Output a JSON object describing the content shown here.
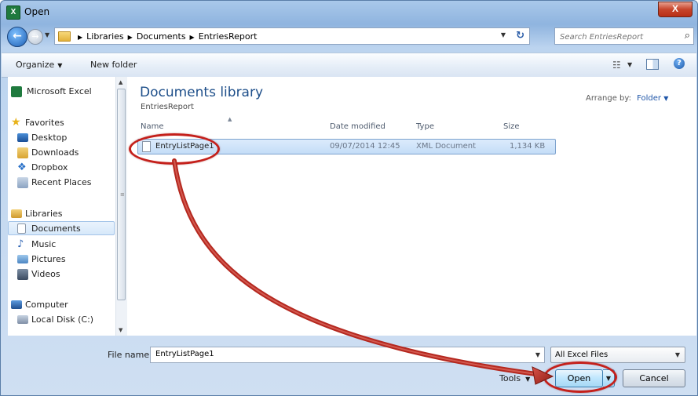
{
  "window": {
    "title": "Open",
    "app_icon_letter": "X",
    "close_label": "X"
  },
  "address_bar": {
    "breadcrumbs": [
      "Libraries",
      "Documents",
      "EntriesReport"
    ],
    "search_placeholder": "Search EntriesReport"
  },
  "toolbar": {
    "organize_label": "Organize",
    "new_folder_label": "New folder"
  },
  "nav": {
    "items": [
      {
        "label": "Microsoft Excel",
        "icon": "excel-icon"
      },
      {
        "label": "Favorites",
        "icon": "star-icon"
      },
      {
        "label": "Desktop",
        "icon": "desktop-icon"
      },
      {
        "label": "Downloads",
        "icon": "downloads-icon"
      },
      {
        "label": "Dropbox",
        "icon": "dropbox-icon"
      },
      {
        "label": "Recent Places",
        "icon": "recent-places-icon"
      },
      {
        "label": "Libraries",
        "icon": "libraries-icon"
      },
      {
        "label": "Documents",
        "icon": "documents-icon"
      },
      {
        "label": "Music",
        "icon": "music-icon"
      },
      {
        "label": "Pictures",
        "icon": "pictures-icon"
      },
      {
        "label": "Videos",
        "icon": "videos-icon"
      },
      {
        "label": "Computer",
        "icon": "computer-icon"
      },
      {
        "label": "Local Disk (C:)",
        "icon": "disk-icon"
      }
    ],
    "selected": "Documents"
  },
  "content": {
    "title": "Documents library",
    "subtitle": "EntriesReport",
    "arrange_label": "Arrange by:",
    "arrange_value": "Folder",
    "columns": [
      "Name",
      "Date modified",
      "Type",
      "Size"
    ],
    "files": [
      {
        "name": "EntryListPage1",
        "date": "09/07/2014 12:45",
        "type": "XML Document",
        "size": "1,134 KB"
      }
    ]
  },
  "footer": {
    "file_name_label": "File name:",
    "file_name_value": "EntryListPage1",
    "filter_value": "All Excel Files",
    "tools_label": "Tools",
    "open_label": "Open",
    "cancel_label": "Cancel"
  },
  "colors": {
    "annotation": "#c4201b",
    "accent": "#1e4f8a"
  }
}
